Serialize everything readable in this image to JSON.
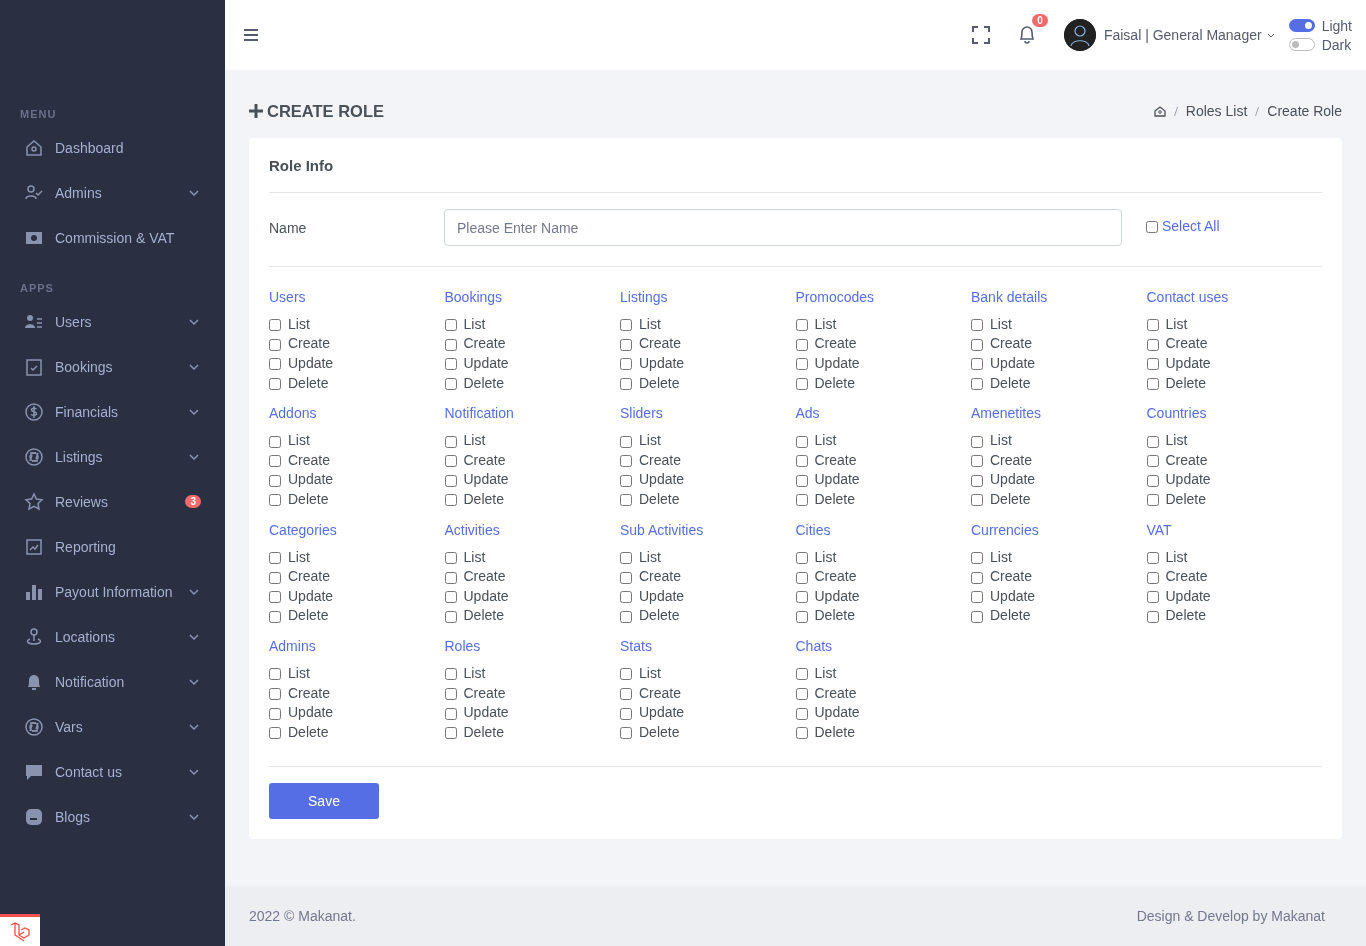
{
  "sidebar": {
    "sections": [
      {
        "title": "MENU",
        "items": [
          {
            "label": "Dashboard",
            "expandable": false
          },
          {
            "label": "Admins",
            "expandable": true
          },
          {
            "label": "Commission & VAT",
            "expandable": false
          }
        ]
      },
      {
        "title": "APPS",
        "items": [
          {
            "label": "Users",
            "expandable": true
          },
          {
            "label": "Bookings",
            "expandable": true
          },
          {
            "label": "Financials",
            "expandable": true
          },
          {
            "label": "Listings",
            "expandable": true
          },
          {
            "label": "Reviews",
            "expandable": false,
            "badge": "3"
          },
          {
            "label": "Reporting",
            "expandable": false
          },
          {
            "label": "Payout Information",
            "expandable": true
          },
          {
            "label": "Locations",
            "expandable": true
          },
          {
            "label": "Notification",
            "expandable": true
          },
          {
            "label": "Vars",
            "expandable": true
          },
          {
            "label": "Contact us",
            "expandable": true
          },
          {
            "label": "Blogs",
            "expandable": true
          }
        ]
      }
    ]
  },
  "topbar": {
    "notification_count": "0",
    "user_name": "Faisal | General Manager",
    "theme_toggles": [
      {
        "label": "Light",
        "on": true
      },
      {
        "label": "Dark",
        "on": false
      }
    ]
  },
  "page": {
    "title": "CREATE ROLE",
    "breadcrumb": [
      "Roles List",
      "Create Role"
    ]
  },
  "form": {
    "heading": "Role Info",
    "name_label": "Name",
    "name_placeholder": "Please Enter Name",
    "select_all": {
      "label": "Select All",
      "checked": false
    },
    "groups": [
      {
        "title": "Users",
        "permissions": [
          {
            "label": "List",
            "checked": false
          },
          {
            "label": "Create",
            "checked": false
          },
          {
            "label": "Update",
            "checked": false
          },
          {
            "label": "Delete",
            "checked": false
          }
        ]
      },
      {
        "title": "Bookings",
        "permissions": [
          {
            "label": "List",
            "checked": false
          },
          {
            "label": "Create",
            "checked": false
          },
          {
            "label": "Update",
            "checked": false
          },
          {
            "label": "Delete",
            "checked": false
          }
        ]
      },
      {
        "title": "Listings",
        "permissions": [
          {
            "label": "List",
            "checked": false
          },
          {
            "label": "Create",
            "checked": false
          },
          {
            "label": "Update",
            "checked": false
          },
          {
            "label": "Delete",
            "checked": false
          }
        ]
      },
      {
        "title": "Promocodes",
        "permissions": [
          {
            "label": "List",
            "checked": false
          },
          {
            "label": "Create",
            "checked": false
          },
          {
            "label": "Update",
            "checked": false
          },
          {
            "label": "Delete",
            "checked": false
          }
        ]
      },
      {
        "title": "Bank details",
        "permissions": [
          {
            "label": "List",
            "checked": false
          },
          {
            "label": "Create",
            "checked": false
          },
          {
            "label": "Update",
            "checked": false
          },
          {
            "label": "Delete",
            "checked": false
          }
        ]
      },
      {
        "title": "Contact uses",
        "permissions": [
          {
            "label": "List",
            "checked": false
          },
          {
            "label": "Create",
            "checked": false
          },
          {
            "label": "Update",
            "checked": false
          },
          {
            "label": "Delete",
            "checked": false
          }
        ]
      },
      {
        "title": "Addons",
        "permissions": [
          {
            "label": "List",
            "checked": false
          },
          {
            "label": "Create",
            "checked": false
          },
          {
            "label": "Update",
            "checked": false
          },
          {
            "label": "Delete",
            "checked": false
          }
        ]
      },
      {
        "title": "Notification",
        "permissions": [
          {
            "label": "List",
            "checked": false
          },
          {
            "label": "Create",
            "checked": false
          },
          {
            "label": "Update",
            "checked": false
          },
          {
            "label": "Delete",
            "checked": false
          }
        ]
      },
      {
        "title": "Sliders",
        "permissions": [
          {
            "label": "List",
            "checked": false
          },
          {
            "label": "Create",
            "checked": false
          },
          {
            "label": "Update",
            "checked": false
          },
          {
            "label": "Delete",
            "checked": false
          }
        ]
      },
      {
        "title": "Ads",
        "permissions": [
          {
            "label": "List",
            "checked": false
          },
          {
            "label": "Create",
            "checked": false
          },
          {
            "label": "Update",
            "checked": false
          },
          {
            "label": "Delete",
            "checked": false
          }
        ]
      },
      {
        "title": "Amenetites",
        "permissions": [
          {
            "label": "List",
            "checked": false
          },
          {
            "label": "Create",
            "checked": false
          },
          {
            "label": "Update",
            "checked": false
          },
          {
            "label": "Delete",
            "checked": false
          }
        ]
      },
      {
        "title": "Countries",
        "permissions": [
          {
            "label": "List",
            "checked": false
          },
          {
            "label": "Create",
            "checked": false
          },
          {
            "label": "Update",
            "checked": false
          },
          {
            "label": "Delete",
            "checked": false
          }
        ]
      },
      {
        "title": "Categories",
        "permissions": [
          {
            "label": "List",
            "checked": false
          },
          {
            "label": "Create",
            "checked": false
          },
          {
            "label": "Update",
            "checked": false
          },
          {
            "label": "Delete",
            "checked": false
          }
        ]
      },
      {
        "title": "Activities",
        "permissions": [
          {
            "label": "List",
            "checked": false
          },
          {
            "label": "Create",
            "checked": false
          },
          {
            "label": "Update",
            "checked": false
          },
          {
            "label": "Delete",
            "checked": false
          }
        ]
      },
      {
        "title": "Sub Activities",
        "permissions": [
          {
            "label": "List",
            "checked": false
          },
          {
            "label": "Create",
            "checked": false
          },
          {
            "label": "Update",
            "checked": false
          },
          {
            "label": "Delete",
            "checked": false
          }
        ]
      },
      {
        "title": "Cities",
        "permissions": [
          {
            "label": "List",
            "checked": false
          },
          {
            "label": "Create",
            "checked": false
          },
          {
            "label": "Update",
            "checked": false
          },
          {
            "label": "Delete",
            "checked": false
          }
        ]
      },
      {
        "title": "Currencies",
        "permissions": [
          {
            "label": "List",
            "checked": false
          },
          {
            "label": "Create",
            "checked": false
          },
          {
            "label": "Update",
            "checked": false
          },
          {
            "label": "Delete",
            "checked": false
          }
        ]
      },
      {
        "title": "VAT",
        "permissions": [
          {
            "label": "List",
            "checked": false
          },
          {
            "label": "Create",
            "checked": false
          },
          {
            "label": "Update",
            "checked": false
          },
          {
            "label": "Delete",
            "checked": false
          }
        ]
      },
      {
        "title": "Admins",
        "permissions": [
          {
            "label": "List",
            "checked": false
          },
          {
            "label": "Create",
            "checked": false
          },
          {
            "label": "Update",
            "checked": false
          },
          {
            "label": "Delete",
            "checked": false
          }
        ]
      },
      {
        "title": "Roles",
        "permissions": [
          {
            "label": "List",
            "checked": false
          },
          {
            "label": "Create",
            "checked": false
          },
          {
            "label": "Update",
            "checked": false
          },
          {
            "label": "Delete",
            "checked": false
          }
        ]
      },
      {
        "title": "Stats",
        "permissions": [
          {
            "label": "List",
            "checked": false
          },
          {
            "label": "Create",
            "checked": false
          },
          {
            "label": "Update",
            "checked": false
          },
          {
            "label": "Delete",
            "checked": false
          }
        ]
      },
      {
        "title": "Chats",
        "permissions": [
          {
            "label": "List",
            "checked": false
          },
          {
            "label": "Create",
            "checked": false
          },
          {
            "label": "Update",
            "checked": false
          },
          {
            "label": "Delete",
            "checked": false
          }
        ]
      }
    ],
    "save_button": "Save"
  },
  "footer": {
    "copyright": "2022 © Makanat.",
    "credit": "Design & Develop by Makanat"
  }
}
